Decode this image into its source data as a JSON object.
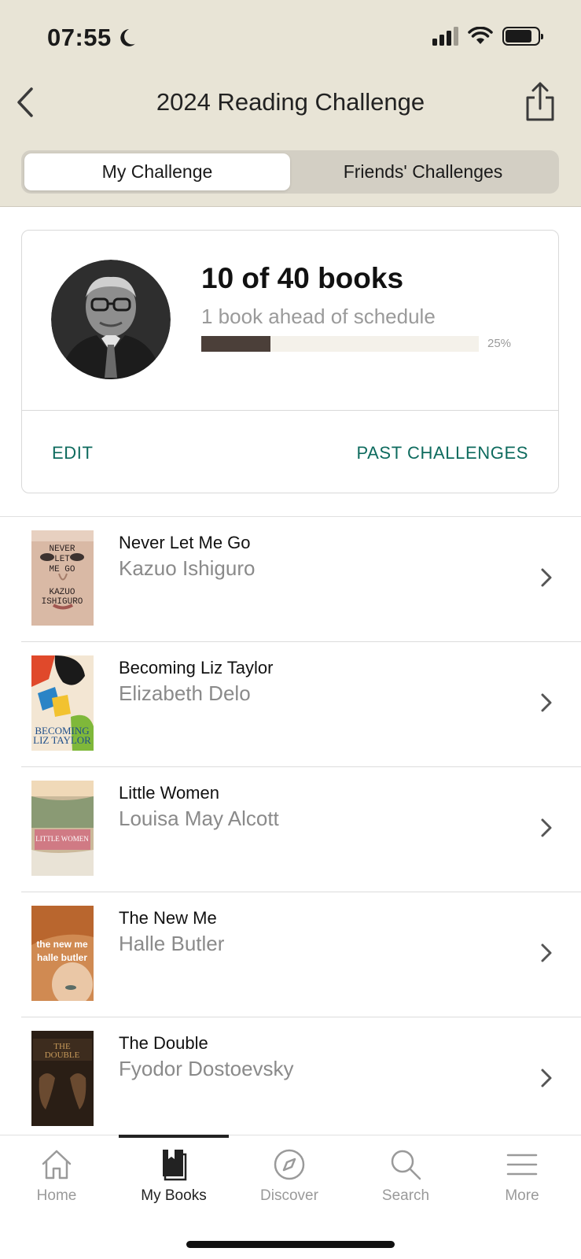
{
  "status_bar": {
    "time": "07:55"
  },
  "nav": {
    "title": "2024 Reading Challenge"
  },
  "segments": {
    "my": "My Challenge",
    "friends": "Friends' Challenges"
  },
  "challenge": {
    "headline": "10 of 40 books",
    "subtitle": "1 book ahead of schedule",
    "progress_value": 0.25,
    "progress_label": "25%",
    "edit_label": "EDIT",
    "past_label": "PAST CHALLENGES"
  },
  "books": [
    {
      "title": "Never Let Me Go",
      "author": "Kazuo Ishiguro"
    },
    {
      "title": "Becoming Liz Taylor",
      "author": "Elizabeth Delo"
    },
    {
      "title": "Little Women",
      "author": "Louisa May Alcott"
    },
    {
      "title": "The New Me",
      "author": "Halle Butler"
    },
    {
      "title": "The Double",
      "author": "Fyodor Dostoevsky"
    }
  ],
  "tabs": {
    "home": "Home",
    "mybooks": "My Books",
    "discover": "Discover",
    "search": "Search",
    "more": "More",
    "active": "My Books"
  },
  "colors": {
    "header_bg": "#e8e4d6",
    "accent_green": "#0e6b5e",
    "progress_fill": "#4b3f39",
    "progress_track": "#f4f1ea"
  },
  "icons": [
    "back-chevron-icon",
    "share-icon",
    "moon-icon",
    "signal-icon",
    "wifi-icon",
    "battery-icon",
    "row-chevron-icon",
    "home-icon",
    "book-icon",
    "compass-icon",
    "search-icon",
    "menu-icon"
  ]
}
